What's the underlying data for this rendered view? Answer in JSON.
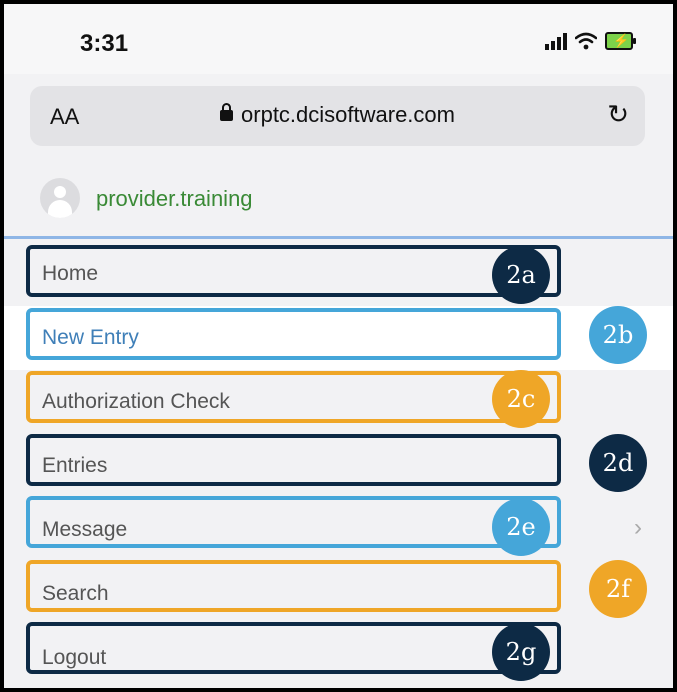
{
  "status_bar": {
    "time": "3:31"
  },
  "browser": {
    "text_size_label": "AA",
    "url": "orptc.dcisoftware.com"
  },
  "user": {
    "name": "provider.training"
  },
  "menu": [
    {
      "label": "Home",
      "callout": "2a"
    },
    {
      "label": "New Entry",
      "callout": "2b"
    },
    {
      "label": "Authorization Check",
      "callout": "2c"
    },
    {
      "label": "Entries",
      "callout": "2d"
    },
    {
      "label": "Message",
      "callout": "2e"
    },
    {
      "label": "Search",
      "callout": "2f"
    },
    {
      "label": "Logout",
      "callout": "2g"
    }
  ],
  "colors": {
    "navy": "#0d2a45",
    "blue": "#45a6d9",
    "orange": "#efa627",
    "username_green": "#3a8a36"
  }
}
